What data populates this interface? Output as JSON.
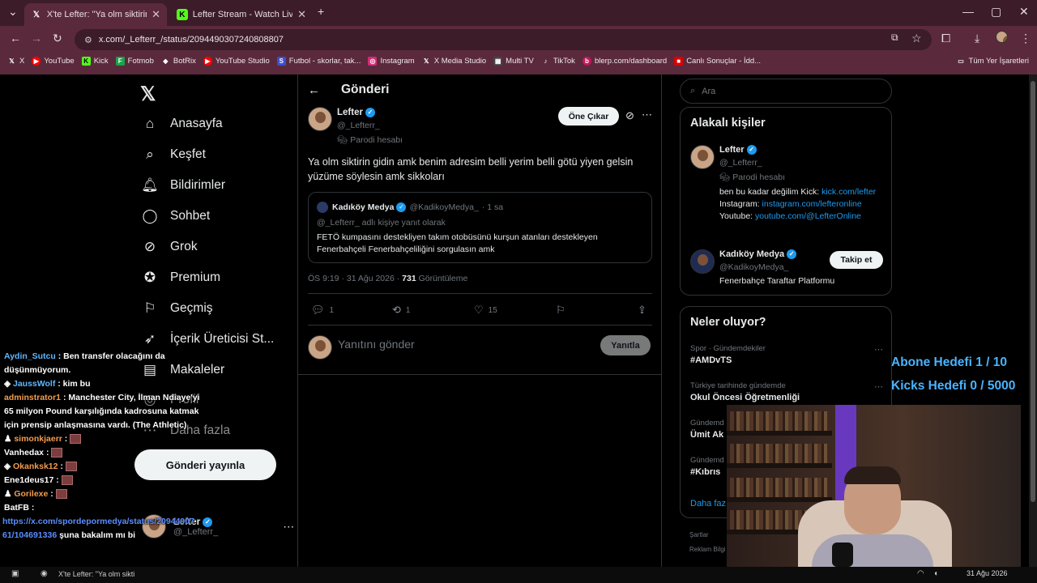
{
  "browser": {
    "tabs": [
      {
        "title": "X'te Lefter: \"Ya olm siktirin gidin",
        "icon": "x-logo-icon",
        "active": true
      },
      {
        "title": "Lefter Stream - Watch Live on K",
        "icon": "kick-logo-icon",
        "active": false
      }
    ],
    "url": "x.com/_Lefterr_/status/2094490307240808807",
    "bookmarks": [
      "X",
      "YouTube",
      "Kick",
      "Fotmob",
      "BotRix",
      "YouTube Studio",
      "Futbol - skorlar, tak...",
      "Instagram",
      "X Media Studio",
      "Multi TV",
      "TikTok",
      "blerp.com/dashboard",
      "Canlı Sonuçlar - İdd..."
    ],
    "all_bookmarks": "Tüm Yer İşaretleri"
  },
  "nav": {
    "items": [
      {
        "label": "Anasayfa",
        "icon": "home-icon"
      },
      {
        "label": "Keşfet",
        "icon": "search-icon"
      },
      {
        "label": "Bildirimler",
        "icon": "bell-icon"
      },
      {
        "label": "Sohbet",
        "icon": "chat-icon"
      },
      {
        "label": "Grok",
        "icon": "grok-icon"
      },
      {
        "label": "Premium",
        "icon": "premium-icon"
      },
      {
        "label": "Geçmiş",
        "icon": "bookmark-icon"
      },
      {
        "label": "İçerik Üreticisi St...",
        "icon": "rocket-icon"
      },
      {
        "label": "Makaleler",
        "icon": "article-icon"
      },
      {
        "label": "Profil",
        "icon": "profile-icon"
      },
      {
        "label": "Daha fazla",
        "icon": "more-icon"
      }
    ],
    "post_button": "Gönderi yayınla",
    "account": {
      "name": "Lefter",
      "handle": "@_Lefterr_"
    }
  },
  "post": {
    "header": "Gönderi",
    "author": {
      "name": "Lefter",
      "handle": "@_Lefterr_",
      "label": "Parodi hesabı"
    },
    "feature_button": "Öne Çıkar",
    "text": "Ya olm siktirin gidin amk benim adresim belli yerim belli götü yiyen gelsin yüzüme söylesin amk sikkoları",
    "quote": {
      "name": "Kadıköy Medya",
      "handle": "@KadikoyMedya_",
      "time": "· 1 sa",
      "reply_to": "@_Lefterr_ adlı kişiye yanıt olarak",
      "text": "FETÖ kumpasını destekliyen takım otobüsünü kurşun atanları destekleyen Fenerbahçeli Fenerbahçeliliğini sorgulasın amk"
    },
    "meta_time": "ÖS 9:19 · 31 Ağu 2026 · ",
    "views_count": "731",
    "views_label": " Görüntüleme",
    "stats": {
      "replies": "1",
      "reposts": "1",
      "likes": "15"
    },
    "reply_placeholder": "Yanıtını gönder",
    "reply_button": "Yanıtla"
  },
  "sidebar": {
    "search_placeholder": "Ara",
    "related_title": "Alakalı kişiler",
    "person1": {
      "name": "Lefter",
      "handle": "@_Lefterr_",
      "label": "Parodi hesabı",
      "bio_1": "ben bu kadar değilim Kick:",
      "link_1": "kick.com/lefter",
      "bio_2": " Instagram:",
      "link_2": "instagram.com/lefteronline",
      "bio_3": " Youtube:",
      "link_3": "youtube.com/@LefterOnline"
    },
    "person2": {
      "name": "Kadıköy Medya",
      "handle": "@KadikoyMedya_",
      "bio": "Fenerbahçe Taraftar Platformu",
      "follow": "Takip et"
    },
    "trends_title": "Neler oluyor?",
    "trends": [
      {
        "context": "Spor · Gündemdekiler",
        "title": "#AMDvTS"
      },
      {
        "context": "Türkiye tarihinde gündemde",
        "title": "Okul Öncesi Öğretmenliği"
      },
      {
        "context": "Gündemd",
        "title": "Ümit Ak"
      },
      {
        "context": "Gündemd",
        "title": "#Kıbrıs"
      }
    ],
    "show_more": "Daha faz",
    "footer_1": "Şartlar",
    "footer_2": "Reklam Bilgi"
  },
  "stream": {
    "goal_sub": "Abone Hedefi 1 / 10",
    "goal_kicks": "Kicks Hedefi 0 / 5000",
    "chat": [
      {
        "user": "Aydin_Sutcu",
        "msg": " : Ben transfer olacağını da düşünmüyorum."
      },
      {
        "user": "JaussWolf",
        "msg": " : kim bu"
      },
      {
        "user": "adminstrator1",
        "msg": " : Manchester City, İlman Ndiaye'yi 65 milyon Pound karşılığında kadrosuna katmak için prensip anlaşmasına vardı. (The Athletic)"
      },
      {
        "user": "simonkjaerr",
        "msg": " :"
      },
      {
        "user": "Vanhedax",
        "msg": " :"
      },
      {
        "user": "Okanksk12",
        "msg": " :"
      },
      {
        "user": "Ene1deus17",
        "msg": " :"
      },
      {
        "user": "Gorilexe",
        "msg": " :"
      },
      {
        "user": "BatFB",
        "msg": " :"
      }
    ],
    "chat_link": "https://x.com/spordepormedya/status/20944907",
    "chat_tail_1": "61/104691336",
    "chat_tail_2": " şuna bakalım mı bi"
  },
  "taskbar": {
    "window_title": "X'te Lefter: \"Ya olm sikti",
    "date": "31 Ağu 2026"
  }
}
